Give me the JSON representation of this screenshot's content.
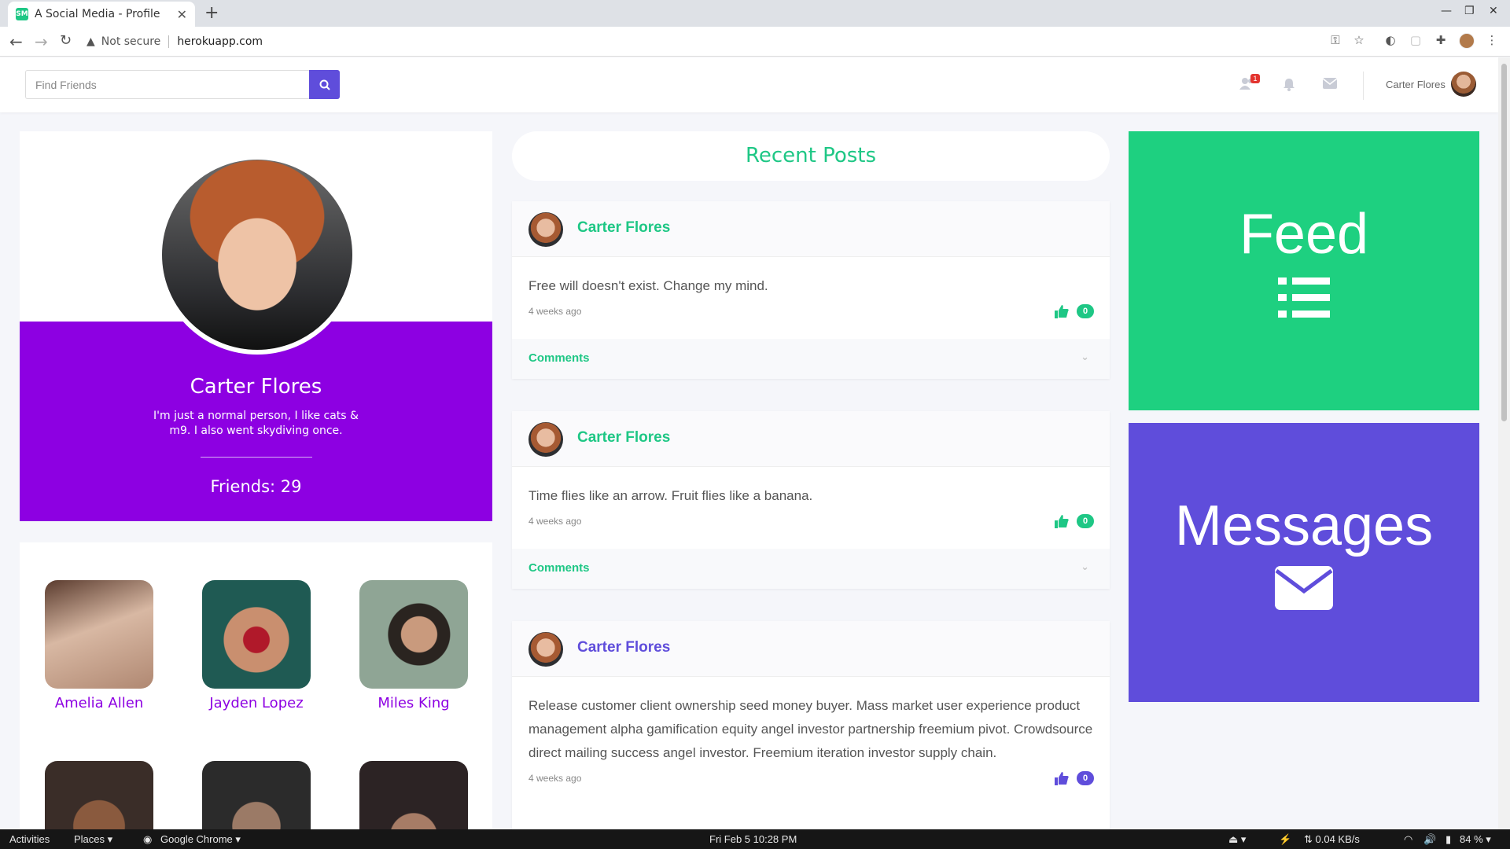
{
  "browser": {
    "tab_title": "A Social Media - Profile",
    "favicon_text": "SM",
    "not_secure": "Not secure",
    "url": "herokuapp.com"
  },
  "header": {
    "search_placeholder": "Find Friends",
    "notification_badge": "1",
    "user_name": "Carter Flores"
  },
  "profile": {
    "name": "Carter Flores",
    "bio": "I'm just a normal person, I like cats & m9. I also went skydiving once.",
    "friends_label": "Friends: 29"
  },
  "friends": [
    {
      "name": "Amelia Allen",
      "color": "#c9a891"
    },
    {
      "name": "Jayden Lopez",
      "color": "#1f5a53"
    },
    {
      "name": "Miles King",
      "color": "#6a7f73"
    },
    {
      "name": "",
      "color": "#4a3b33"
    },
    {
      "name": "",
      "color": "#2a2a2a"
    },
    {
      "name": "",
      "color": "#3a2a2a"
    }
  ],
  "recent_posts_title": "Recent Posts",
  "posts": [
    {
      "author": "Carter Flores",
      "text": "Free will doesn't exist. Change my mind.",
      "time": "4 weeks ago",
      "likes": "0",
      "comments_label": "Comments",
      "accent": "#1ec785"
    },
    {
      "author": "Carter Flores",
      "text": "Time flies like an arrow. Fruit flies like a banana.",
      "time": "4 weeks ago",
      "likes": "0",
      "comments_label": "Comments",
      "accent": "#1ec785"
    },
    {
      "author": "Carter Flores",
      "text": "Release customer client ownership seed money buyer. Mass market user experience product management alpha gamification equity angel investor partnership freemium pivot. Crowdsource direct mailing success angel investor. Freemium iteration investor supply chain.",
      "time": "4 weeks ago",
      "likes": "0",
      "accent": "#5f4ddb"
    }
  ],
  "tiles": {
    "feed_label": "Feed",
    "messages_label": "Messages"
  },
  "taskbar": {
    "activities": "Activities",
    "places": "Places ▾",
    "app": "Google Chrome ▾",
    "datetime": "Fri Feb 5  10:28 PM",
    "network": "⇅ 0.04 KB/s",
    "battery": "84 % ▾"
  },
  "colors": {
    "green": "#1ec785",
    "purple": "#8d00e2",
    "indigo": "#5f4ddb"
  }
}
